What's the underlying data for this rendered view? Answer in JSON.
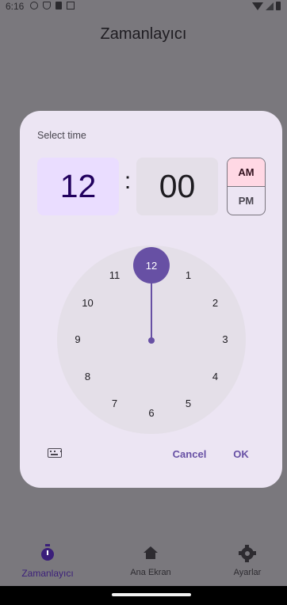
{
  "status_bar": {
    "time": "6:16",
    "left_icons": [
      "info-circle-icon",
      "shield-icon",
      "sim-card-icon",
      "notification-icon"
    ],
    "right_icons": [
      "wifi-icon",
      "signal-icon",
      "battery-icon"
    ]
  },
  "app": {
    "title": "Zamanlayıcı"
  },
  "time_picker": {
    "label": "Select time",
    "hour": "12",
    "separator": ":",
    "minute": "00",
    "am_label": "AM",
    "pm_label": "PM",
    "selected_period": "AM",
    "selected_hour": "12",
    "clock_numbers": [
      "12",
      "1",
      "2",
      "3",
      "4",
      "5",
      "6",
      "7",
      "8",
      "9",
      "10",
      "11"
    ],
    "cancel_label": "Cancel",
    "ok_label": "OK",
    "input_mode_icon": "keyboard-icon"
  },
  "bottom_nav": {
    "items": [
      {
        "label": "Zamanlayıcı",
        "icon": "stopwatch-icon",
        "active": true
      },
      {
        "label": "Ana Ekran",
        "icon": "home-icon",
        "active": false
      },
      {
        "label": "Ayarlar",
        "icon": "gear-icon",
        "active": false
      }
    ]
  },
  "colors": {
    "scrim": "#7a787d",
    "dialog": "#ece5f3",
    "primary": "#6750a4",
    "hour_container": "#eaddff",
    "am_selected": "#ffd8e4",
    "clock_face": "#e4dfe8"
  }
}
